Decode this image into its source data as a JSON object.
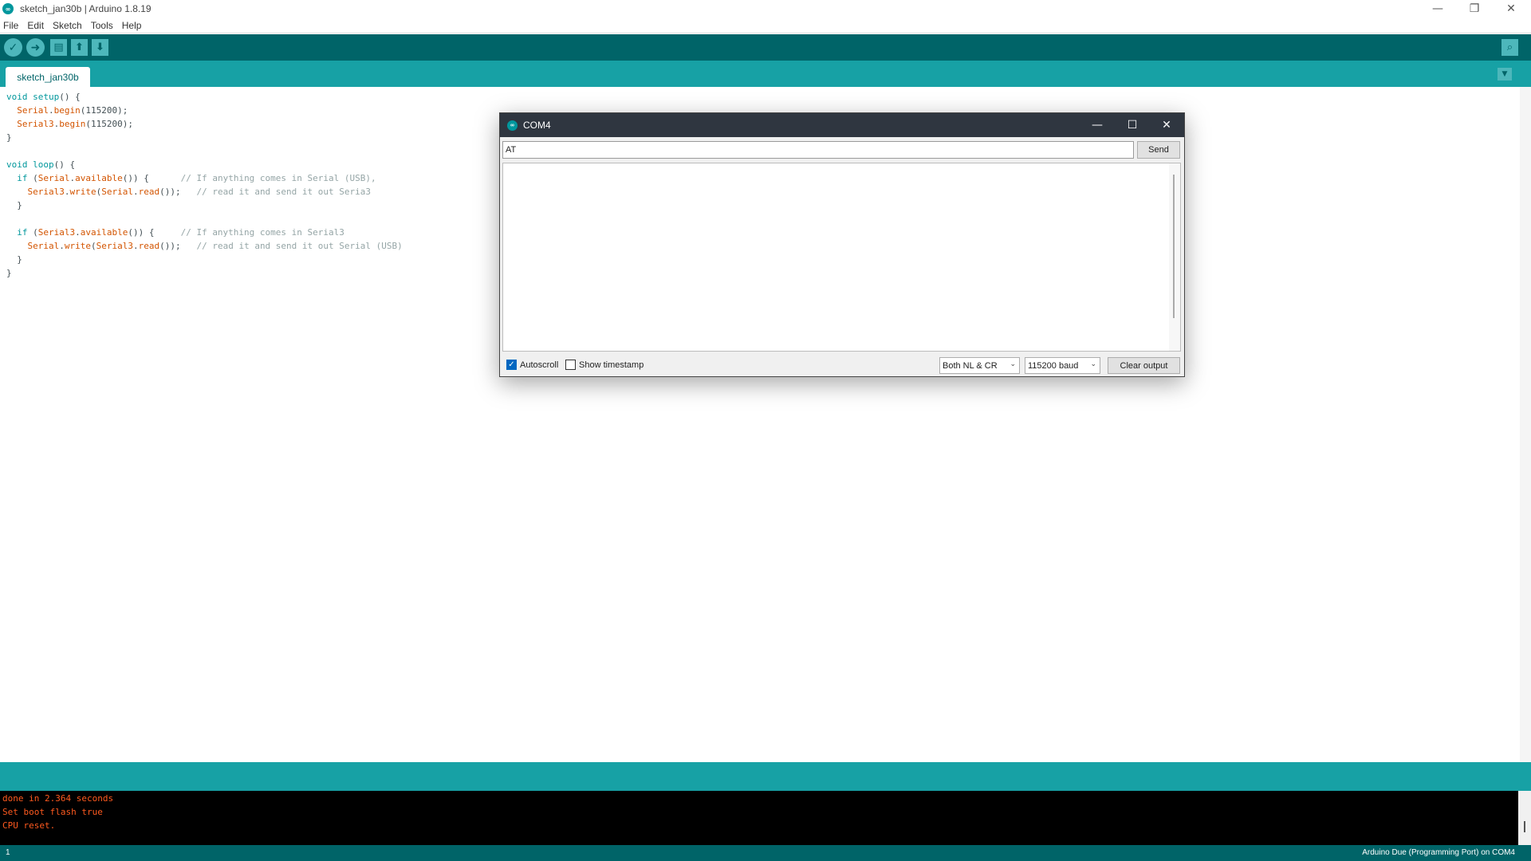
{
  "window": {
    "title": "sketch_jan30b | Arduino 1.8.19",
    "minimize": "—",
    "restore": "❐",
    "close": "✕"
  },
  "menu": [
    "File",
    "Edit",
    "Sketch",
    "Tools",
    "Help"
  ],
  "toolbar": {
    "verify_icon": "check-icon",
    "upload_icon": "arrow-right-icon",
    "new_icon": "file-icon",
    "open_icon": "arrow-up-icon",
    "save_icon": "arrow-down-icon",
    "serial_monitor_icon": "magnifier-icon"
  },
  "tabs": [
    {
      "label": "sketch_jan30b"
    }
  ],
  "editor": {
    "lines": [
      "void setup() {",
      "  Serial.begin(115200);",
      "  Serial3.begin(115200);",
      "}",
      "",
      "void loop() {",
      "  if (Serial.available()) {      // If anything comes in Serial (USB),",
      "    Serial3.write(Serial.read());   // read it and send it out Seria3",
      "  }",
      "",
      "  if (Serial3.available()) {     // If anything comes in Serial3",
      "    Serial.write(Serial3.read());   // read it and send it out Serial (USB)",
      "  }",
      "}"
    ]
  },
  "console": {
    "lines": [
      "done in 2.364 seconds",
      "Set boot flash true",
      "CPU reset."
    ]
  },
  "status": {
    "line_number": "1",
    "board": "Arduino Due (Programming Port) on COM4"
  },
  "serial_monitor": {
    "title": "COM4",
    "input_value": "AT",
    "send_label": "Send",
    "output_text": "",
    "autoscroll_label": "Autoscroll",
    "autoscroll_checked": true,
    "timestamp_label": "Show timestamp",
    "timestamp_checked": false,
    "line_ending": "Both NL & CR",
    "baud": "115200 baud",
    "clear_label": "Clear output"
  },
  "colors": {
    "toolbar": "#006468",
    "tabstrip": "#17a1a5",
    "console_text": "#ff5a1f",
    "keyword": "#00979c",
    "function": "#d35400",
    "comment": "#95a5a6"
  }
}
